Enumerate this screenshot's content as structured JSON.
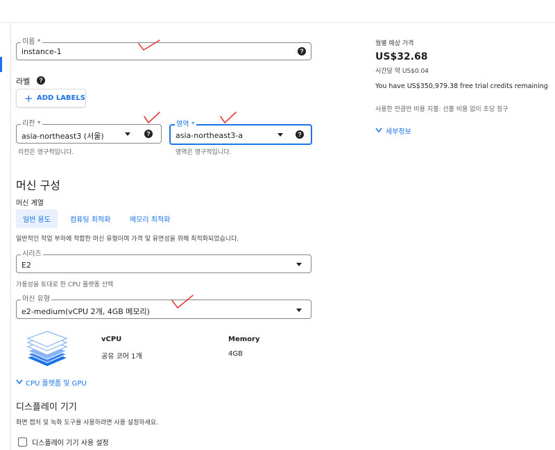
{
  "name_field": {
    "label": "이름 *",
    "value": "instance-1"
  },
  "labels": {
    "title": "라벨",
    "add_button": "ADD LABELS"
  },
  "region": {
    "label": "리전 *",
    "value": "asia-northeast3 (서울)",
    "hint": "리전은 영구적입니다."
  },
  "zone": {
    "label": "영역 *",
    "value": "asia-northeast3-a",
    "hint": "영역은 영구적입니다."
  },
  "machine": {
    "heading": "머신 구성",
    "family_label": "머신 계열",
    "tabs": [
      "일반 용도",
      "컴퓨팅 최적화",
      "메모리 최적화"
    ],
    "active_tab": 0,
    "description": "일반적인 작업 부하에 적합한 머신 유형이며 가격 및 유연성을 위해 최적화되었습니다.",
    "series": {
      "label": "시리즈",
      "value": "E2",
      "hint": "가용성을 토대로 한 CPU 플랫폼 선택"
    },
    "type": {
      "label": "머신 유형",
      "value": "e2-medium(vCPU 2개, 4GB 메모리)"
    },
    "specs": {
      "vcpu_title": "vCPU",
      "vcpu_value": "공유 코어 1개",
      "memory_title": "Memory",
      "memory_value": "4GB"
    },
    "cpu_platform_link": "CPU 플랫폼 및 GPU"
  },
  "display": {
    "heading": "디스플레이 기기",
    "description": "화면 캡처 및 녹화 도구를 사용하려면 사용 설정하세요.",
    "checkbox_label": "디스플레이 기기 사용 설정",
    "checked": false
  },
  "pricing": {
    "title": "월별 예상 가격",
    "monthly": "US$32.68",
    "hourly": "시간당 약 US$0.04",
    "credits": "You have US$350,979.38 free trial credits remaining",
    "billing_note": "사용한 만큼만 비용 지불: 선불 비용 없이 초당 청구",
    "details_link": "세부정보"
  },
  "colors": {
    "accent": "#1a73e8",
    "annotation": "#e53935",
    "text": "#202124",
    "muted": "#5f6368"
  }
}
